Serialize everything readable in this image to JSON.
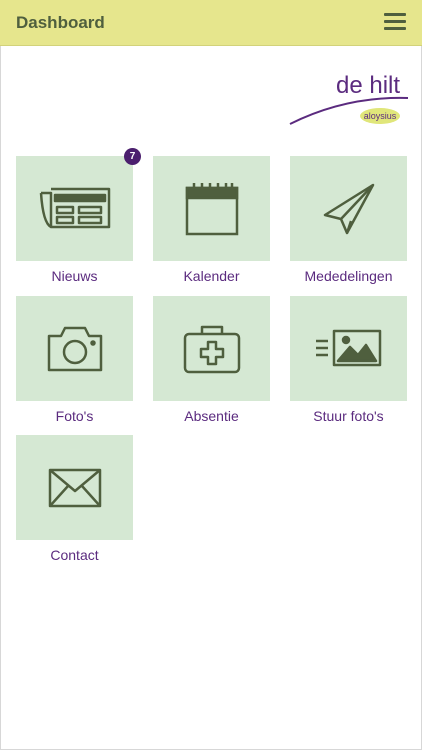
{
  "header": {
    "title": "Dashboard"
  },
  "logo": {
    "top": "de hilt",
    "sub": "aloysius"
  },
  "tiles": [
    {
      "id": "nieuws",
      "label": "Nieuws",
      "badge": "7",
      "icon": "newspaper-icon"
    },
    {
      "id": "kalender",
      "label": "Kalender",
      "icon": "calendar-icon"
    },
    {
      "id": "mededelingen",
      "label": "Mededelingen",
      "icon": "paper-plane-icon"
    },
    {
      "id": "fotos",
      "label": "Foto's",
      "icon": "camera-icon"
    },
    {
      "id": "absentie",
      "label": "Absentie",
      "icon": "medical-kit-icon"
    },
    {
      "id": "stuur-fotos",
      "label": "Stuur foto's",
      "icon": "send-photo-icon"
    },
    {
      "id": "contact",
      "label": "Contact",
      "icon": "envelope-icon"
    }
  ],
  "colors": {
    "header": "#e6e68d",
    "tile": "#d5e8d3",
    "label": "#5b2b7f",
    "icon": "#4f5f3e"
  }
}
